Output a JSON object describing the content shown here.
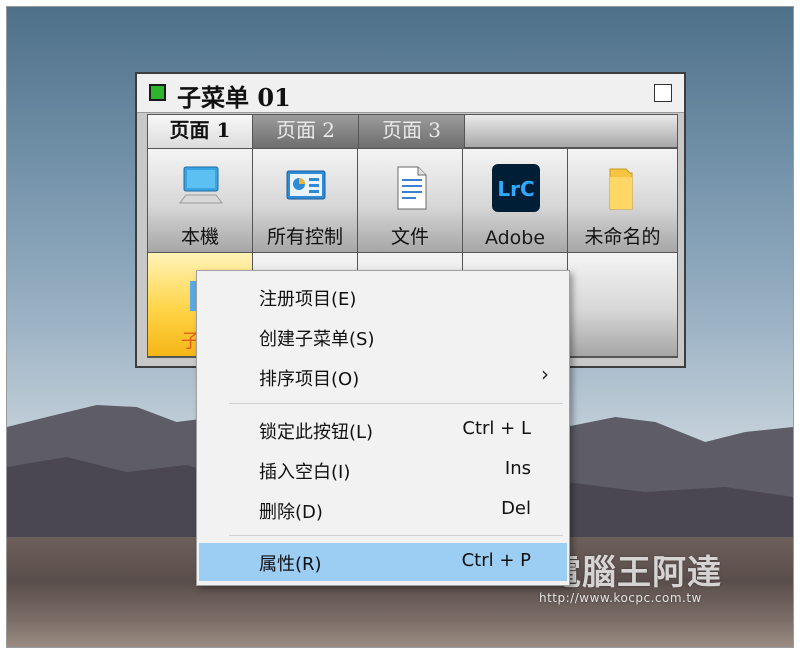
{
  "window": {
    "title": "子菜单 01",
    "tabs": [
      {
        "label": "页面 1",
        "active": true
      },
      {
        "label": "页面 2",
        "active": false
      },
      {
        "label": "页面 3",
        "active": false
      }
    ],
    "items": [
      {
        "label": "本機",
        "icon": "computer-icon"
      },
      {
        "label": "所有控制",
        "icon": "control-panel-icon"
      },
      {
        "label": "文件",
        "icon": "document-icon"
      },
      {
        "label": "Adobe",
        "icon": "lightroom-icon"
      },
      {
        "label": "未命名的",
        "icon": "folder-icon"
      }
    ],
    "selected_item": {
      "label": "子菜",
      "icon": "folder-icon"
    }
  },
  "context_menu": {
    "items": [
      {
        "label": "注册项目(E)",
        "shortcut": ""
      },
      {
        "label": "创建子菜单(S)",
        "shortcut": ""
      },
      {
        "label": "排序项目(O)",
        "shortcut": "",
        "submenu_icon": "chevron-right-icon"
      },
      {
        "label": "锁定此按钮(L)",
        "shortcut": "Ctrl + L"
      },
      {
        "label": "插入空白(I)",
        "shortcut": "Ins"
      },
      {
        "label": "删除(D)",
        "shortcut": "Del"
      },
      {
        "label": "属性(R)",
        "shortcut": "Ctrl + P"
      }
    ],
    "highlight_color": "#9ccdf3"
  },
  "watermark": {
    "title": "電腦王阿達",
    "url": "http://www.kocpc.com.tw"
  },
  "colors": {
    "accent_green": "#2db52d",
    "selected_tile": "#ffd447",
    "selected_label": "#e0601a"
  }
}
